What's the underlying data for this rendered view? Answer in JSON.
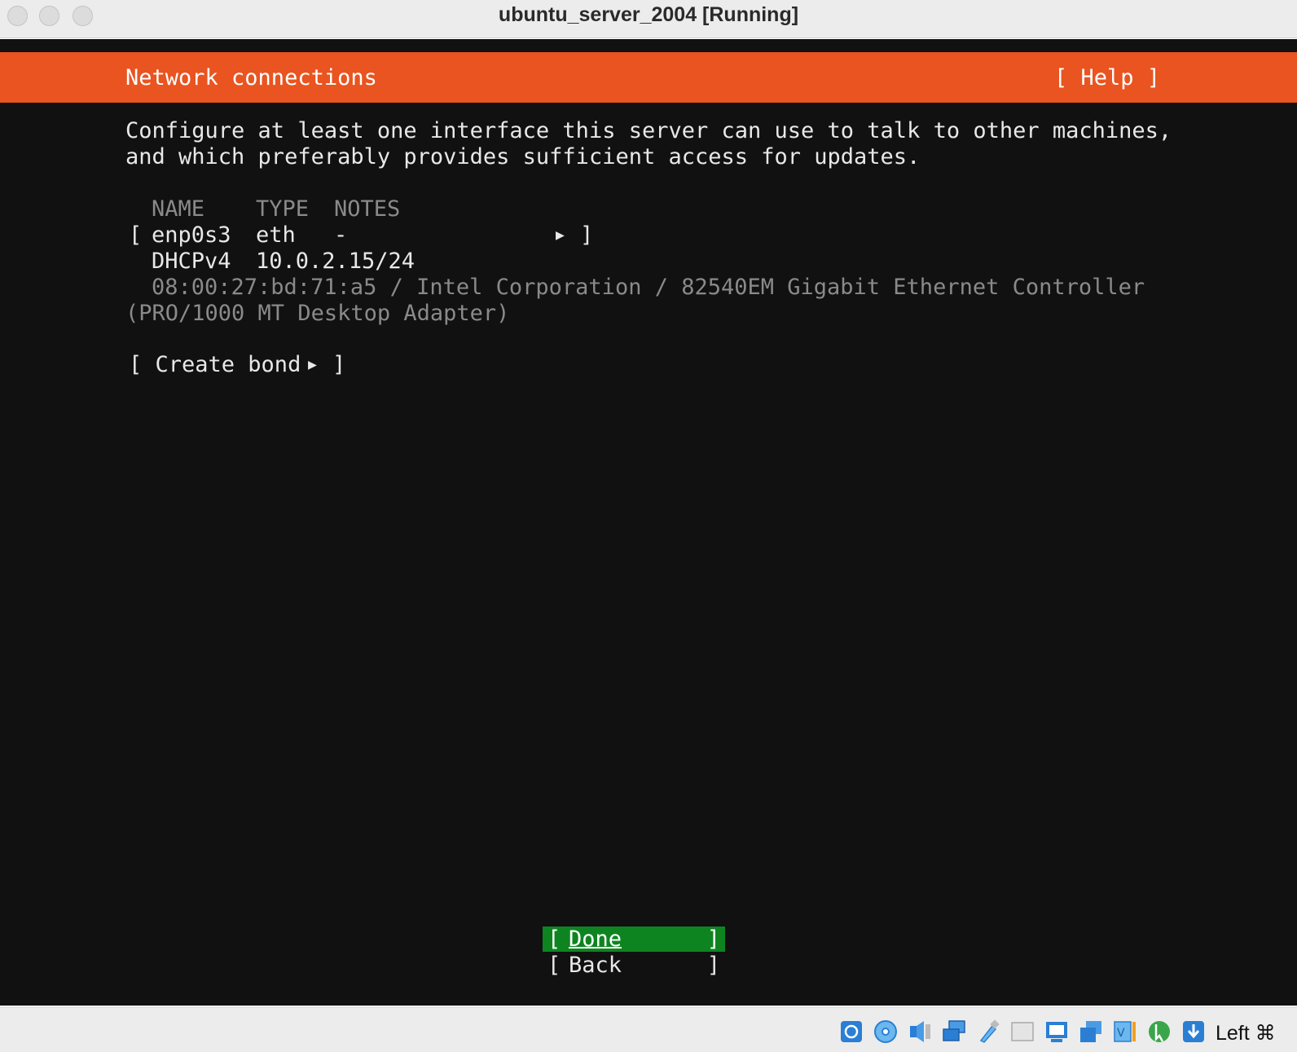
{
  "window": {
    "title": "ubuntu_server_2004 [Running]"
  },
  "header": {
    "title": "Network connections",
    "help": "[ Help ]"
  },
  "intro": {
    "line1": "Configure at least one interface this server can use to talk to other machines,",
    "line2": "and which preferably provides sufficient access for updates."
  },
  "table": {
    "columns": [
      "NAME",
      "TYPE",
      "NOTES"
    ],
    "interface": {
      "bracket_open": "[",
      "name": "enp0s3",
      "type": "eth",
      "notes": "-",
      "bracket_close": "]",
      "dhcp_label": "DHCPv4",
      "address": "10.0.2.15/24",
      "hw_line1": "08:00:27:bd:71:a5 / Intel Corporation / 82540EM Gigabit Ethernet Controller",
      "hw_line2": "(PRO/1000 MT Desktop Adapter)"
    }
  },
  "create_bond": {
    "open": "[ Create bond",
    "close": "]"
  },
  "buttons": {
    "done": "Done",
    "back": "Back"
  },
  "status": {
    "host_key": "Left ⌘"
  },
  "colors": {
    "accent": "#e95420",
    "focus": "#0e8420",
    "background": "#111111"
  },
  "statusbar_icons": [
    "hard-disk-icon",
    "optical-drive-icon",
    "audio-icon",
    "network-icon",
    "usb-icon",
    "shared-folder-icon",
    "display-icon",
    "video-capture-icon",
    "cpu-icon",
    "mouse-integration-icon",
    "download-arrow-icon"
  ]
}
